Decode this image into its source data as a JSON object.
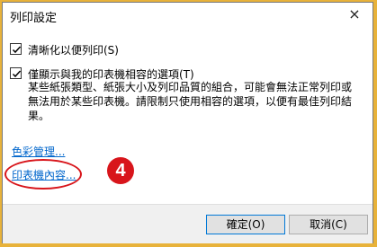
{
  "dialog": {
    "title": "列印設定",
    "close_icon": "×"
  },
  "options": [
    {
      "label": "清晰化以便列印(S)",
      "checked": true
    },
    {
      "label": "僅顯示與我的印表機相容的選項(T)",
      "checked": true
    }
  ],
  "description": "某些紙張類型、紙張大小及列印品質的組合，可能會無法正常列印或無法用於某些印表機。請限制只使用相容的選項，以便有最佳列印結果。",
  "links": {
    "color_management": "色彩管理...",
    "printer_properties": "印表機內容..."
  },
  "annotation": {
    "step_number": "4",
    "color": "#d8151b"
  },
  "buttons": {
    "ok": "確定(O)",
    "cancel": "取消(C)"
  }
}
